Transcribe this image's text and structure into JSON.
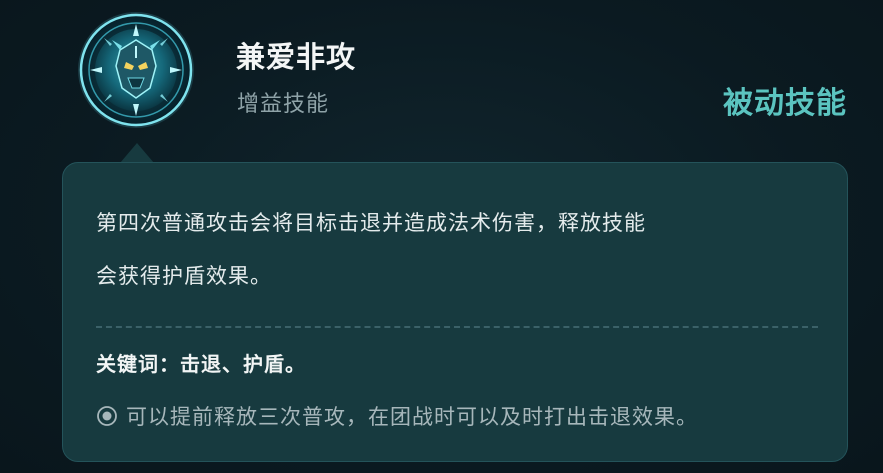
{
  "skill": {
    "name": "兼爱非攻",
    "category": "增益技能",
    "type": "被动技能",
    "icon": "mechanical-guardian-emblem-icon"
  },
  "description": {
    "line1": "第四次普通攻击会将目标击退并造成法术伤害，释放技能",
    "line2": "会获得护盾效果。"
  },
  "keywords": "关键词：击退、护盾。",
  "tip": {
    "icon": "target-dot-icon",
    "text": "可以提前释放三次普攻，在团战时可以及时打出击退效果。"
  },
  "colors": {
    "background": "#0b1b22",
    "panel": "#173a3f",
    "accent": "#5bc4c0"
  }
}
